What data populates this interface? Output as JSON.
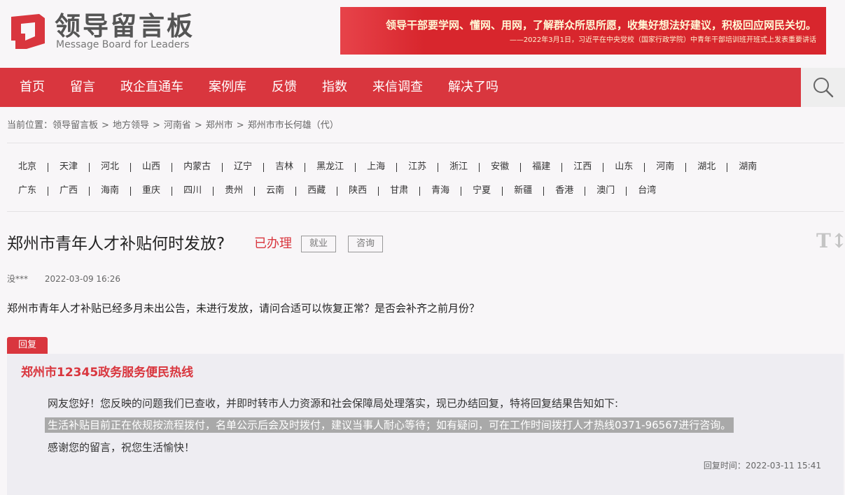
{
  "header": {
    "logo_cn": "领导留言板",
    "logo_en": "Message Board for Leaders",
    "banner_main": "领导干部要学网、懂网、用网，了解群众所思所愿，收集好想法好建议，积极回应网民关切。",
    "banner_sub": "——2022年3月1日，习近平在中央党校（国家行政学院）中青年干部培训班开班式上发表重要讲话",
    "brand_color": "#d9363e"
  },
  "nav": {
    "items": [
      "首页",
      "留言",
      "政企直通车",
      "案例库",
      "反馈",
      "指数",
      "来信调查",
      "解决了吗"
    ],
    "search_icon": "search-icon"
  },
  "breadcrumb": {
    "prefix": "当前位置：",
    "items": [
      "领导留言板",
      "地方领导",
      "河南省",
      "郑州市",
      "郑州市市长何雄（代）"
    ],
    "separator": ">"
  },
  "regions": {
    "row1": [
      "北京",
      "天津",
      "河北",
      "山西",
      "内蒙古",
      "辽宁",
      "吉林",
      "黑龙江",
      "上海",
      "江苏",
      "浙江",
      "安徽",
      "福建",
      "江西",
      "山东",
      "河南",
      "湖北",
      "湖南"
    ],
    "row2": [
      "广东",
      "广西",
      "海南",
      "重庆",
      "四川",
      "贵州",
      "云南",
      "西藏",
      "陕西",
      "甘肃",
      "青海",
      "宁夏",
      "新疆",
      "香港",
      "澳门",
      "台湾"
    ]
  },
  "message": {
    "title": "郑州市青年人才补贴何时发放?",
    "status": "已办理",
    "tags": [
      "就业",
      "咨询"
    ],
    "font_toggle": "T↕",
    "author": "没***",
    "time": "2022-03-09 16:26",
    "body": "郑州市青年人才补贴已经多月未出公告，未进行发放，请问合适可以恢复正常？是否会补齐之前月份？"
  },
  "reply": {
    "tab_label": "回复",
    "org": "郑州市12345政务服务便民热线",
    "p1": "网友您好！您反映的问题我们已查收，并即时转市人力资源和社会保障局处理落实，现已办结回复，特将回复结果告知如下:",
    "p2": "生活补贴目前正在依规按流程拨付，名单公示后会及时拨付，建议当事人耐心等待；如有疑问，可在工作时间拨打人才热线0371-96567进行咨询。",
    "p3": "感谢您的留言，祝您生活愉快！",
    "time_label": "回复时间：",
    "time": "2022-03-11 15:41"
  }
}
